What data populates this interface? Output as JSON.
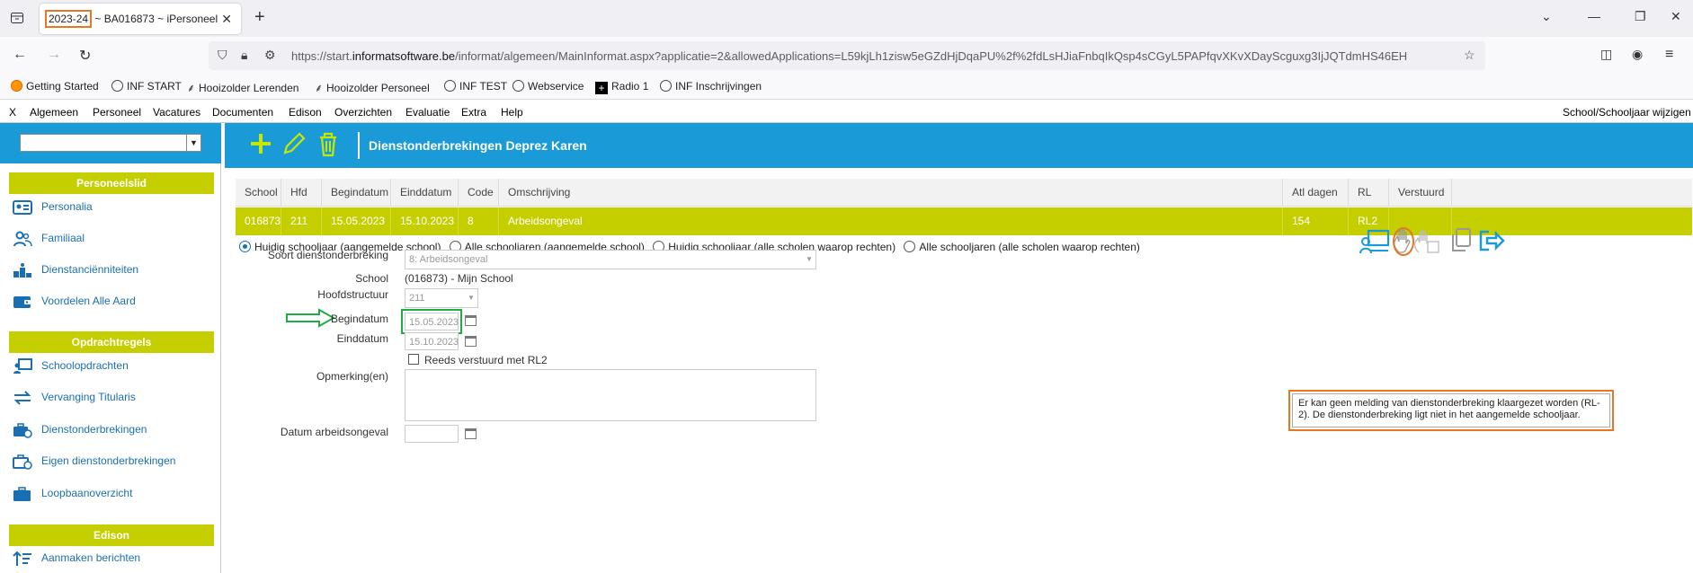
{
  "browser": {
    "tab_title_year": "2023-24",
    "tab_title_rest": " ~ BA016873 ~ iPersoneel",
    "url_prefix": "https://start.",
    "url_domain": "informatsoftware.be",
    "url_rest": "/informat/algemeen/MainInformat.aspx?applicatie=2&allowedApplications=L59kjLh1zisw5eGZdHjDqaPU%2f%2fdLsHJiaFnbqIkQsp4sCGyL5PAPfqvXKvXDayScguxg3IjJQTdmHS46EH",
    "bookmarks": [
      "Getting Started",
      "INF START",
      "Hooizolder Lerenden",
      "Hooizolder Personeel",
      "INF TEST",
      "Webservice",
      "Radio 1",
      "INF Inschrijvingen"
    ]
  },
  "menu": {
    "items": [
      "X",
      "Algemeen",
      "Personeel",
      "Vacatures",
      "Documenten",
      "Edison",
      "Overzichten",
      "Evaluatie",
      "Extra",
      "Help"
    ],
    "right": "School/Schooljaar wijzigen"
  },
  "sidebar": {
    "sections": [
      {
        "title": "Personeelslid",
        "items": [
          "Personalia",
          "Familiaal",
          "Dienstanciënniteiten",
          "Voordelen Alle Aard"
        ]
      },
      {
        "title": "Opdrachtregels",
        "items": [
          "Schoolopdrachten",
          "Vervanging Titularis",
          "Dienstonderbrekingen",
          "Eigen dienstonderbrekingen",
          "Loopbaanoverzicht"
        ]
      },
      {
        "title": "Edison",
        "items": [
          "Aanmaken berichten"
        ]
      }
    ]
  },
  "header": {
    "title": "Dienstonderbrekingen Deprez Karen"
  },
  "grid": {
    "columns": [
      "School",
      "Hfd",
      "Begindatum",
      "Einddatum",
      "Code",
      "Omschrijving",
      "Atl dagen",
      "RL",
      "Verstuurd"
    ],
    "row": [
      "016873",
      "211",
      "15.05.2023",
      "15.10.2023",
      "8",
      "Arbeidsongeval",
      "154",
      "RL2",
      ""
    ]
  },
  "radios": [
    {
      "label": "Huidig schooljaar (aangemelde school)",
      "checked": true
    },
    {
      "label": "Alle schooljaren (aangemelde school)",
      "checked": false
    },
    {
      "label": "Huidig schooljaar (alle scholen waarop rechten)",
      "checked": false
    },
    {
      "label": "Alle schooljaren (alle scholen waarop rechten)",
      "checked": false
    }
  ],
  "form": {
    "soort_label": "Soort dienstonderbreking",
    "soort_value": "8: Arbeidsongeval",
    "school_label": "School",
    "school_value": "(016873) - Mijn School",
    "hoofd_label": "Hoofdstructuur",
    "hoofd_value": "211",
    "begin_label": "Begindatum",
    "begin_value": "15.05.2023",
    "eind_label": "Einddatum",
    "eind_value": "15.10.2023",
    "rl2_label": "Reeds verstuurd met RL2",
    "opm_label": "Opmerking(en)",
    "datum_label": "Datum arbeidsongeval"
  },
  "tooltip": "Er kan geen melding van dienstonderbreking klaargezet worden (RL-2). De dienstonderbreking ligt niet in het aangemelde schooljaar.",
  "colors": {
    "accent": "#1a9bd7",
    "lime": "#c5cf00",
    "highlight": "#e87722",
    "green": "#22aa44"
  }
}
